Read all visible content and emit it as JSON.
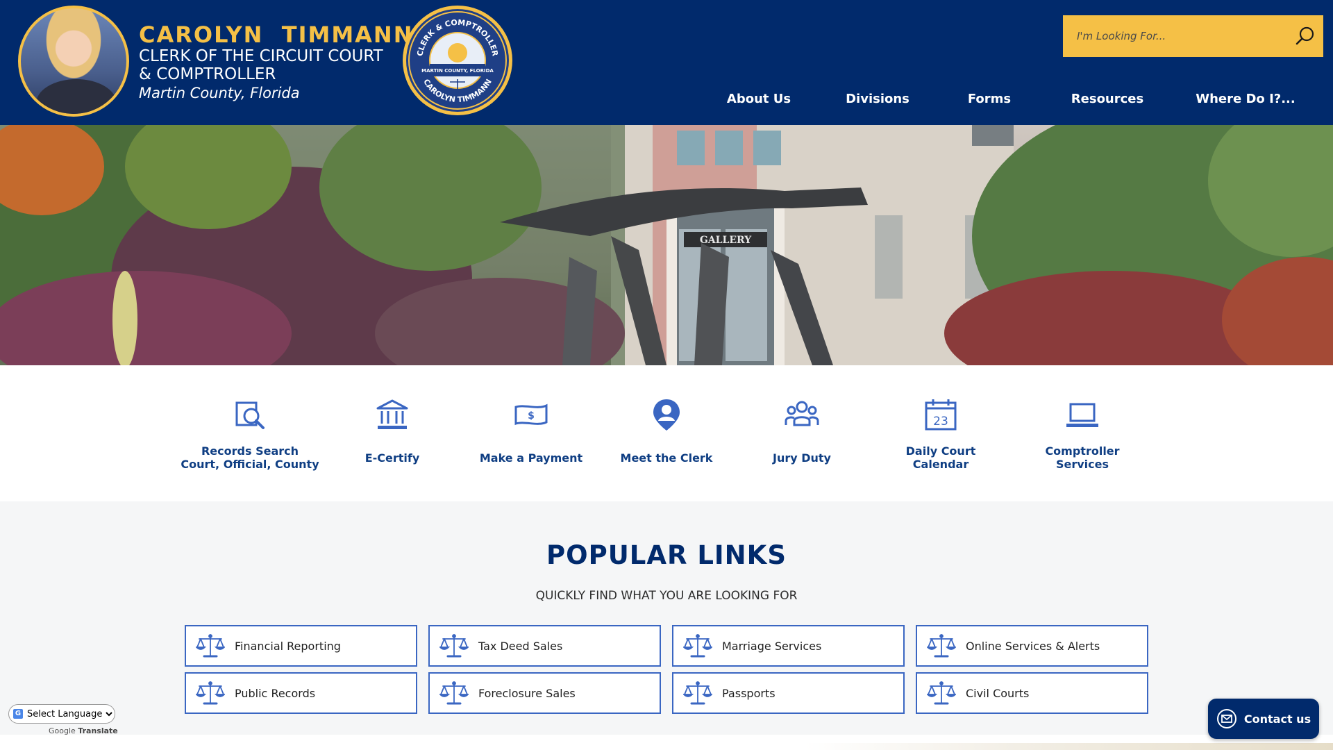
{
  "header": {
    "name": "CAROLYN  TIMMANN",
    "title_line1": "CLERK OF THE CIRCUIT COURT",
    "title_line2": "& COMPTROLLER",
    "location": "Martin County, Florida",
    "seal": {
      "top_text": "CLERK & COMPTROLLER",
      "middle_text": "MARTIN COUNTY, FLORIDA",
      "bottom_text": "CAROLYN TIMMANN"
    }
  },
  "search": {
    "placeholder": "I'm Looking For..."
  },
  "nav": {
    "items": [
      {
        "label": "About Us"
      },
      {
        "label": "Divisions"
      },
      {
        "label": "Forms"
      },
      {
        "label": "Resources"
      },
      {
        "label": "Where Do I?..."
      }
    ]
  },
  "hero": {
    "sign_text": "GALLERY"
  },
  "quick_links": {
    "items": [
      {
        "line1": "Records Search",
        "line2": "Court, Official, County",
        "icon": "records-search-icon"
      },
      {
        "line1": "E-Certify",
        "line2": "",
        "icon": "courthouse-icon"
      },
      {
        "line1": "Make a Payment",
        "line2": "",
        "icon": "payment-icon"
      },
      {
        "line1": "Meet the Clerk",
        "line2": "",
        "icon": "person-pin-icon"
      },
      {
        "line1": "Jury Duty",
        "line2": "",
        "icon": "group-icon"
      },
      {
        "line1": "Daily Court",
        "line2": "Calendar",
        "icon": "calendar-icon",
        "calendar_day": "23"
      },
      {
        "line1": "Comptroller",
        "line2": "Services",
        "icon": "laptop-icon"
      }
    ]
  },
  "popular": {
    "title": "POPULAR LINKS",
    "subtitle": "QUICKLY FIND WHAT YOU ARE LOOKING FOR",
    "items": [
      {
        "label": "Financial Reporting"
      },
      {
        "label": "Tax Deed Sales"
      },
      {
        "label": "Marriage Services"
      },
      {
        "label": "Online Services & Alerts"
      },
      {
        "label": "Public Records"
      },
      {
        "label": "Foreclosure Sales"
      },
      {
        "label": "Passports"
      },
      {
        "label": "Civil Courts"
      }
    ]
  },
  "translate": {
    "select_value": "Select Language",
    "powered_by": "Google",
    "translate_label": "Translate"
  },
  "contact": {
    "label": "Contact us"
  },
  "colors": {
    "navy": "#012a6c",
    "gold": "#f5c046",
    "link_blue": "#3a66c2",
    "icon_blue": "#3a66c2"
  }
}
